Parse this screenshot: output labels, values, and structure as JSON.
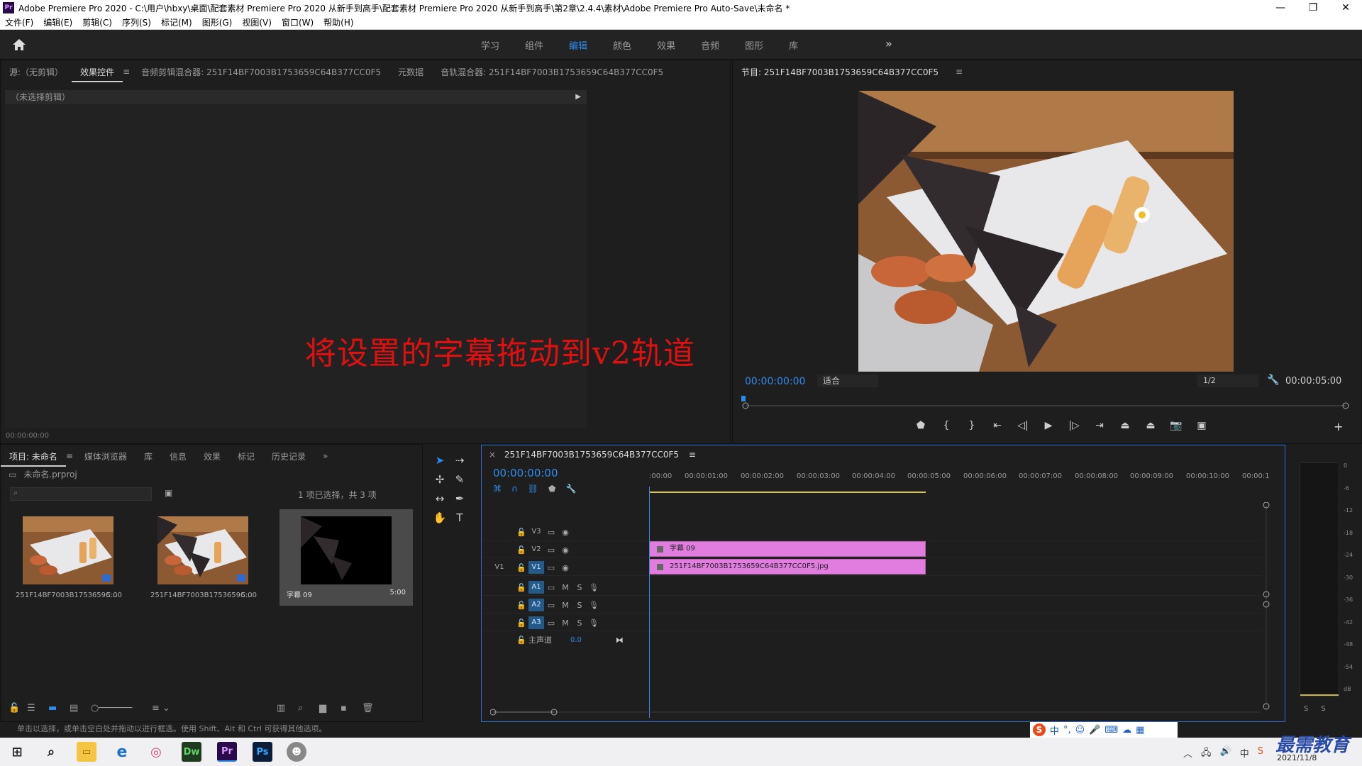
{
  "window": {
    "title": "Adobe Premiere Pro 2020 - C:\\用户\\hbxy\\桌面\\配套素材 Premiere Pro 2020 从新手到高手\\配套素材 Premiere Pro 2020 从新手到高手\\第2章\\2.4.4\\素材\\Adobe Premiere Pro Auto-Save\\未命名 *",
    "app_icon": "Pr",
    "controls": [
      "—",
      "❐",
      "✕"
    ]
  },
  "menu": [
    "文件(F)",
    "编辑(E)",
    "剪辑(C)",
    "序列(S)",
    "标记(M)",
    "图形(G)",
    "视图(V)",
    "窗口(W)",
    "帮助(H)"
  ],
  "workspace": {
    "tabs": [
      "学习",
      "组件",
      "编辑",
      "颜色",
      "效果",
      "音频",
      "图形",
      "库"
    ],
    "active": "编辑",
    "active_accent": "#2d8ceb"
  },
  "source_panel": {
    "tabs": [
      "源:（无剪辑）",
      "效果控件",
      "音频剪辑混合器: 251F14BF7003B1753659C64B377CC0F5",
      "元数据",
      "音轨混合器: 251F14BF7003B1753659C64B377CC0F5"
    ],
    "active_tab": "效果控件",
    "no_clip_label": "（未选择剪辑）",
    "timecode": "00:00:00:00"
  },
  "instruction_overlay": "将设置的字幕拖动到v2轨道",
  "program_monitor": {
    "title": "节目: 251F14BF7003B1753659C64B377CC0F5",
    "timecode_left": "00:00:00:00",
    "fit": "适合",
    "resolution": "1/2",
    "timecode_right": "00:00:05:00"
  },
  "project_panel": {
    "tabs": [
      "项目: 未命名",
      "媒体浏览器",
      "库",
      "信息",
      "效果",
      "标记",
      "历史记录"
    ],
    "active_tab": "项目: 未命名",
    "file": "未命名.prproj",
    "selection_count": "1 项已选择，共 3 项",
    "items": [
      {
        "name": "251F14BF7003B1753659C...",
        "duration": "5:00"
      },
      {
        "name": "251F14BF7003B1753659C...",
        "duration": "5:00"
      },
      {
        "name": "字幕 09",
        "duration": "5:00"
      }
    ]
  },
  "timeline": {
    "sequence": "251F14BF7003B1753659C64B377CC0F5",
    "timecode": "00:00:00:00",
    "ruler": [
      ":00:00",
      "00:00:01:00",
      "00:00:02:00",
      "00:00:03:00",
      "00:00:04:00",
      "00:00:05:00",
      "00:00:06:00",
      "00:00:07:00",
      "00:00:08:00",
      "00:00:09:00",
      "00:00:10:00",
      "00:00:1"
    ],
    "video_tracks": [
      "V3",
      "V2",
      "V1"
    ],
    "audio_tracks": [
      "A1",
      "A2",
      "A3"
    ],
    "source_patch": "V1",
    "master": {
      "label": "主声道",
      "value": "0.0"
    },
    "mute_label": "M",
    "solo_label": "S",
    "clips": [
      {
        "track": "V2",
        "name": "字幕 09"
      },
      {
        "track": "V1",
        "name": "251F14BF7003B1753659C64B377CC0F5.jpg"
      }
    ],
    "clip_color": "#e27de0"
  },
  "audio_meter": {
    "scale": [
      "0",
      "-6",
      "-12",
      "-18",
      "-24",
      "-30",
      "-36",
      "-42",
      "-48",
      "-54",
      "dB"
    ],
    "solo_buttons": [
      "S",
      "S"
    ]
  },
  "status_bar": "单击以选择，或单击空白处并拖动以进行框选。使用 Shift、Alt 和 Ctrl 可获得其他选项。",
  "ime_bar": {
    "logo": "S",
    "label": "中"
  },
  "taskbar": {
    "apps": [
      "Dw",
      "Pr",
      "Ps"
    ],
    "date": "2021/11/8"
  },
  "watermark": "最需教育"
}
